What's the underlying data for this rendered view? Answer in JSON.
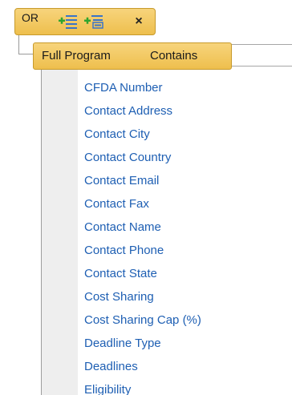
{
  "group": {
    "operator_label": "OR",
    "remove_symbol": "×"
  },
  "condition": {
    "field": "Full Program",
    "operator": "Contains",
    "value": ""
  },
  "field_options": [
    "CFDA Number",
    "Contact Address",
    "Contact City",
    "Contact Country",
    "Contact Email",
    "Contact Fax",
    "Contact Name",
    "Contact Phone",
    "Contact State",
    "Cost Sharing",
    "Cost Sharing Cap (%)",
    "Deadline Type",
    "Deadlines",
    "Eligibility"
  ],
  "colors": {
    "group_fill": "#eebf4d",
    "option_text": "#1e5fb3",
    "add_icon": "#2fa52f",
    "list_icon": "#3a74c9"
  },
  "icons": {
    "add_condition": "add-condition-icon",
    "add_group": "add-group-icon",
    "remove": "close-icon"
  }
}
